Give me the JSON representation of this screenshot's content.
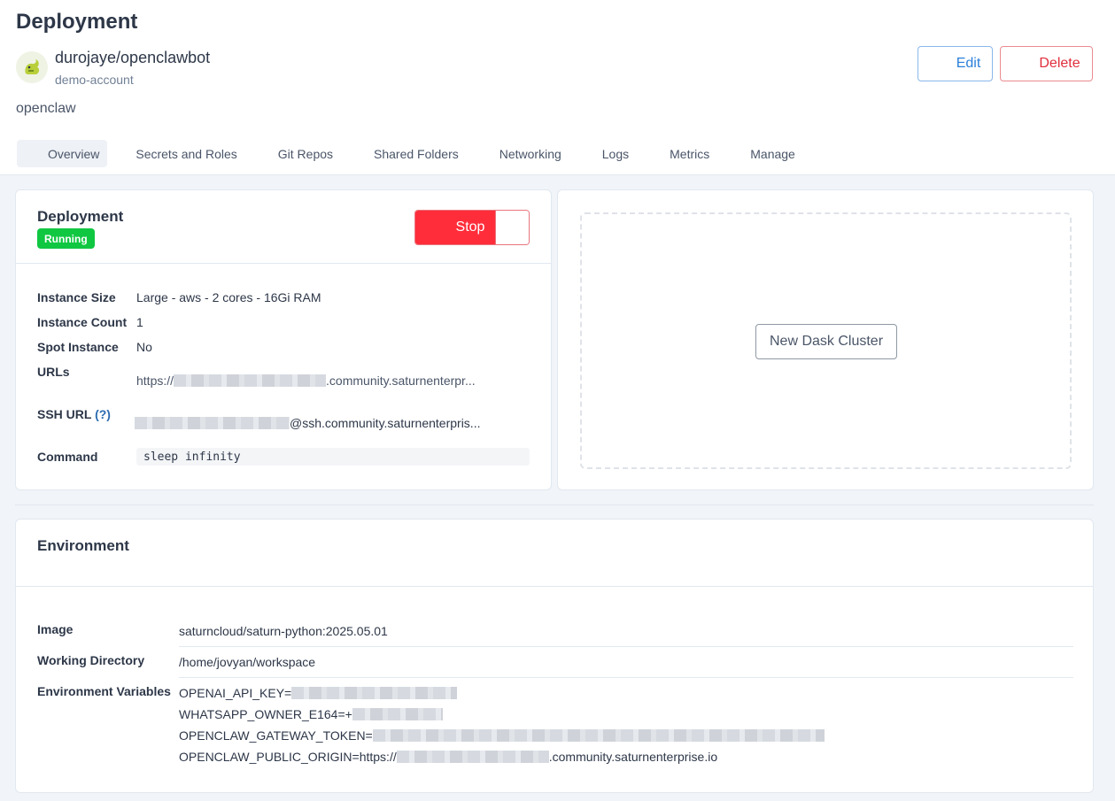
{
  "header": {
    "title": "Deployment",
    "owner": "durojaye/openclawbot",
    "account": "demo-account",
    "resource_name": "openclaw",
    "edit_label": "Edit",
    "delete_label": "Delete"
  },
  "tabs": [
    {
      "label": "Overview",
      "active": true
    },
    {
      "label": "Secrets and Roles"
    },
    {
      "label": "Git Repos"
    },
    {
      "label": "Shared Folders"
    },
    {
      "label": "Networking"
    },
    {
      "label": "Logs"
    },
    {
      "label": "Metrics"
    },
    {
      "label": "Manage"
    }
  ],
  "deployment_card": {
    "title": "Deployment",
    "status": "Running",
    "stop_label": "Stop",
    "fields": {
      "instance_size_label": "Instance Size",
      "instance_size": "Large - aws - 2 cores - 16Gi RAM",
      "instance_count_label": "Instance Count",
      "instance_count": "1",
      "spot_label": "Spot Instance",
      "spot": "No",
      "urls_label": "URLs",
      "url_prefix": "https://",
      "url_suffix": ".community.saturnenterpr...",
      "ssh_label": "SSH URL",
      "ssh_help": "(?)",
      "ssh_suffix": "@ssh.community.saturnenterpris...",
      "command_label": "Command",
      "command": "sleep infinity"
    }
  },
  "dask": {
    "button_label": "New Dask Cluster"
  },
  "environment": {
    "title": "Environment",
    "image_label": "Image",
    "image": "saturncloud/saturn-python:2025.05.01",
    "workdir_label": "Working Directory",
    "workdir": "/home/jovyan/workspace",
    "env_label": "Environment Variables",
    "vars": [
      {
        "prefix": "OPENAI_API_KEY=",
        "suffix": ""
      },
      {
        "prefix": "WHATSAPP_OWNER_E164=+",
        "suffix": ""
      },
      {
        "prefix": "OPENCLAW_GATEWAY_TOKEN=",
        "suffix": ""
      },
      {
        "prefix": "OPENCLAW_PUBLIC_ORIGIN=https://",
        "suffix": ".community.saturnenterprise.io"
      }
    ]
  },
  "colors": {
    "running": "#10c742",
    "stop": "#ff2d3a",
    "edit": "#2b7fd9",
    "delete": "#e02d3c"
  },
  "icons": {
    "avatar": "squirrel-avatar-icon"
  }
}
